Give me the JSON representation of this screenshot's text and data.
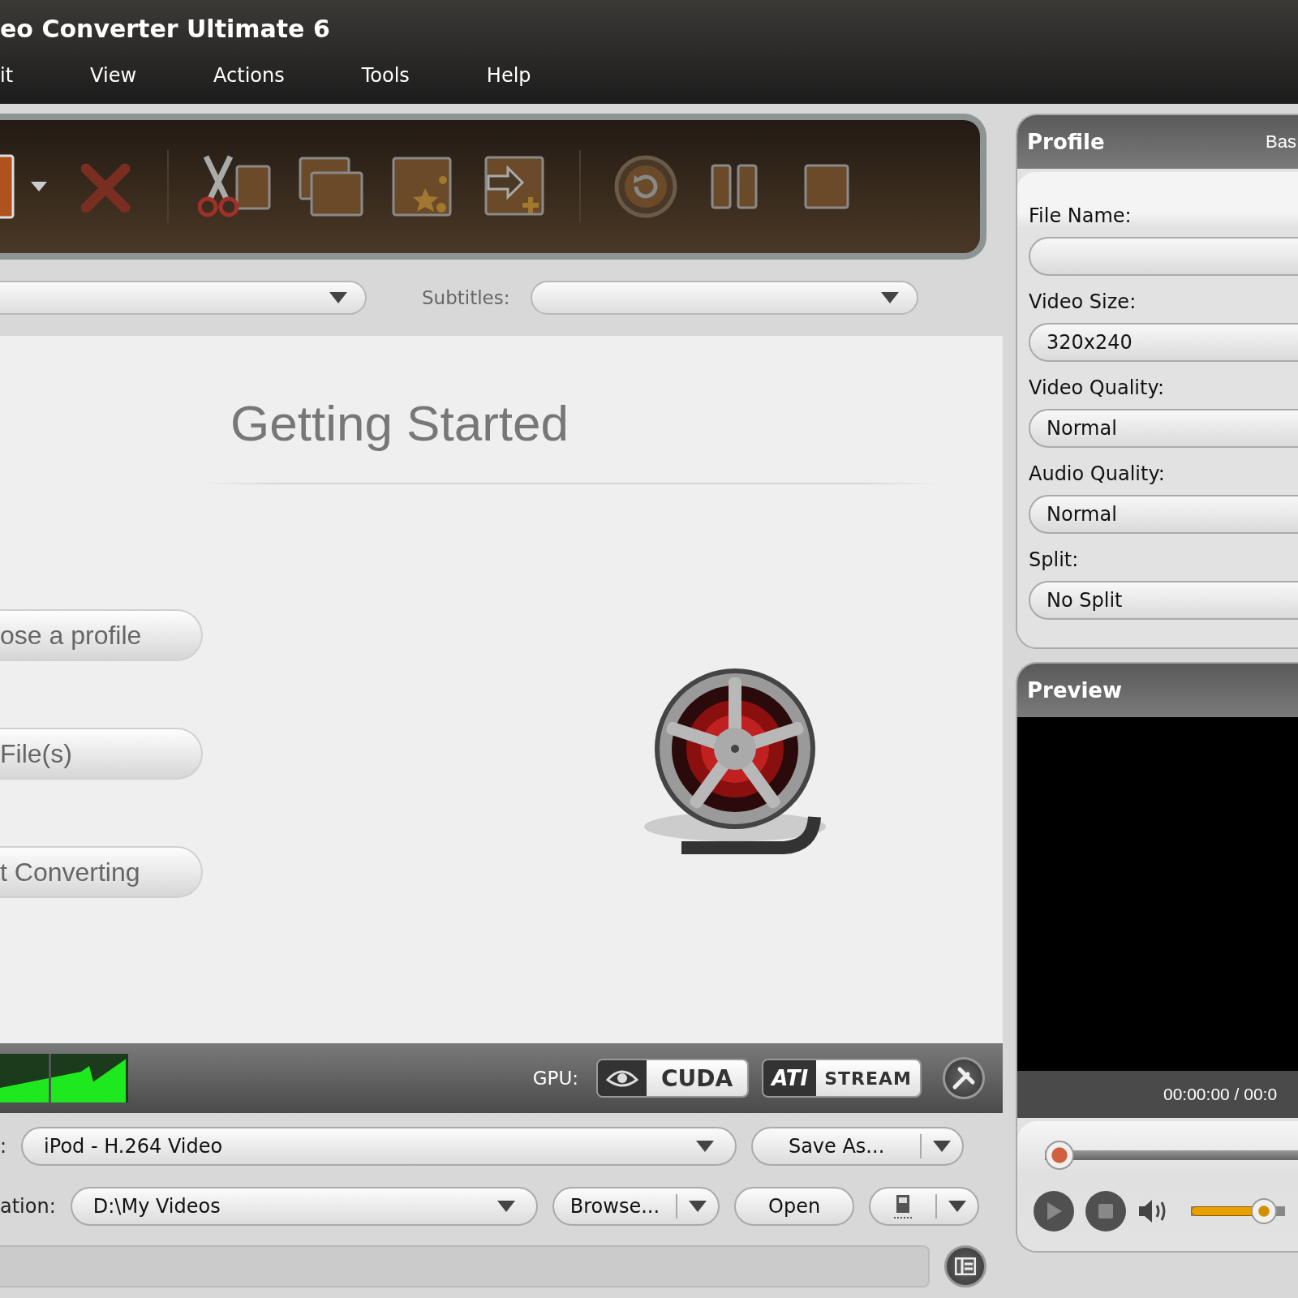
{
  "window": {
    "title": "eo Converter Ultimate 6"
  },
  "menu": [
    "it",
    "View",
    "Actions",
    "Tools",
    "Help"
  ],
  "filters": {
    "subtitles_label": "Subtitles:"
  },
  "getting_started": {
    "title": "Getting Started",
    "steps": [
      "ose a profile",
      "File(s)",
      "t Converting"
    ]
  },
  "gpu": {
    "label": "GPU:",
    "cuda": "CUDA",
    "ati": "ATI",
    "stream": "STREAM"
  },
  "output": {
    "profile_label": ":",
    "profile": "iPod - H.264 Video",
    "save_as": "Save As...",
    "destination_label": "ation:",
    "destination": "D:\\My Videos",
    "browse": "Browse...",
    "open": "Open"
  },
  "profile_panel": {
    "title": "Profile",
    "tab": "Bas",
    "fields": [
      {
        "label": "File Name:"
      },
      {
        "label": "Video Size:",
        "value": "320x240"
      },
      {
        "label": "Video Quality:",
        "value": "Normal"
      },
      {
        "label": "Audio Quality:",
        "value": "Normal"
      },
      {
        "label": "Split:",
        "value": "No Split"
      }
    ]
  },
  "progress": {
    "level": 0
  },
  "preview": {
    "title": "Preview",
    "time": "00:00:00 / 00:0",
    "seek": {
      "level": 0
    },
    "volume": {
      "level": 0.88
    }
  }
}
